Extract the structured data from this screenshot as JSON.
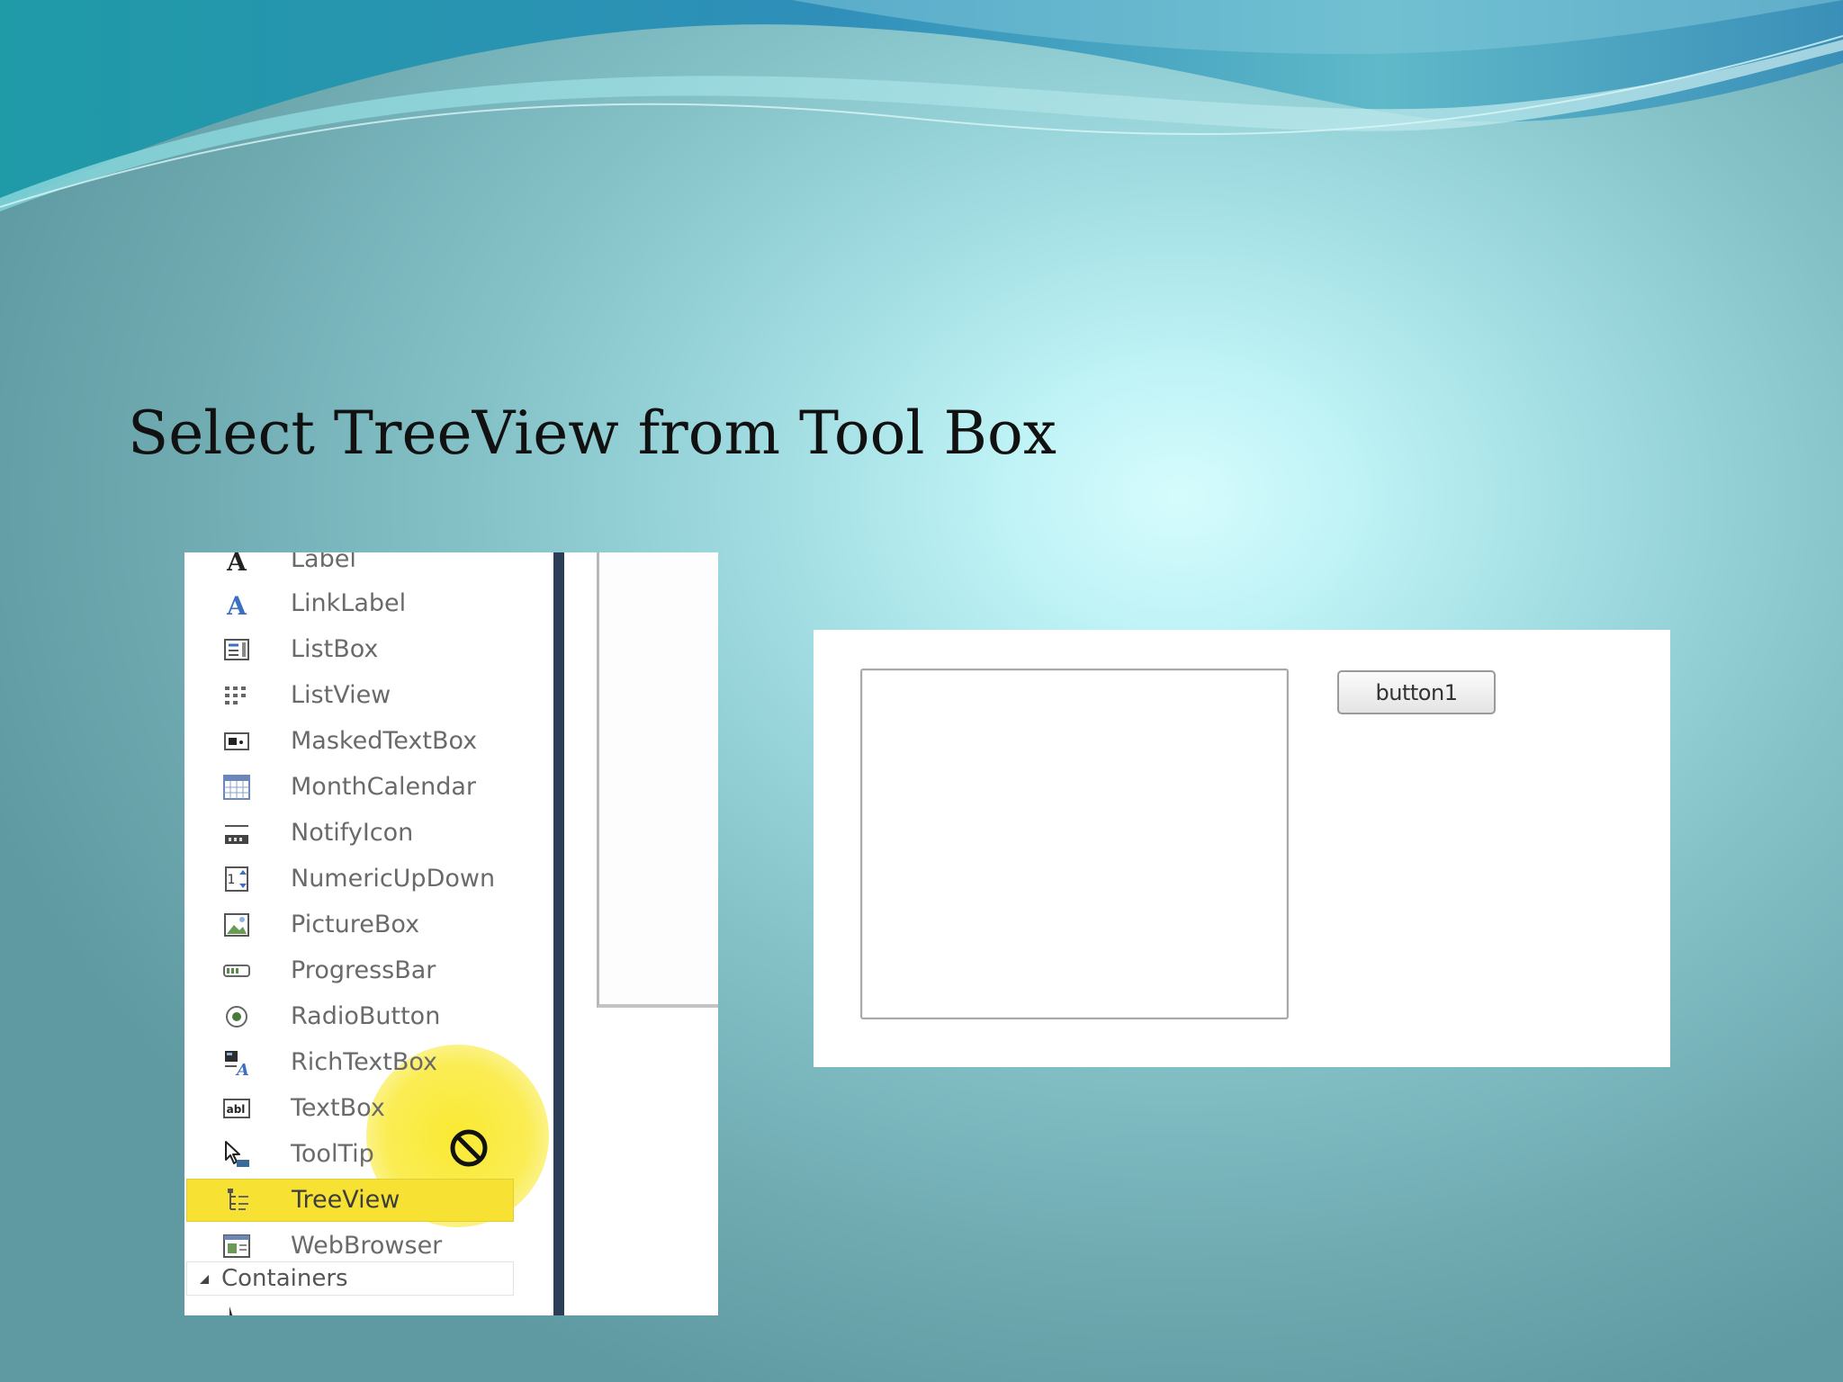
{
  "slide": {
    "title": "Select TreeView from Tool Box"
  },
  "toolbox": {
    "items": [
      {
        "label": "Label",
        "icon": "label-a-icon"
      },
      {
        "label": "LinkLabel",
        "icon": "linklabel-a-icon"
      },
      {
        "label": "ListBox",
        "icon": "listbox-icon"
      },
      {
        "label": "ListView",
        "icon": "listview-icon"
      },
      {
        "label": "MaskedTextBox",
        "icon": "maskedtextbox-icon"
      },
      {
        "label": "MonthCalendar",
        "icon": "calendar-grid-icon"
      },
      {
        "label": "NotifyIcon",
        "icon": "notify-tray-icon"
      },
      {
        "label": "NumericUpDown",
        "icon": "numeric-updown-icon"
      },
      {
        "label": "PictureBox",
        "icon": "picture-icon"
      },
      {
        "label": "ProgressBar",
        "icon": "progressbar-icon"
      },
      {
        "label": "RadioButton",
        "icon": "radio-icon"
      },
      {
        "label": "RichTextBox",
        "icon": "richtext-icon"
      },
      {
        "label": "TextBox",
        "icon": "textbox-abl-icon"
      },
      {
        "label": "ToolTip",
        "icon": "tooltip-pointer-icon"
      },
      {
        "label": "TreeView",
        "icon": "treeview-icon",
        "selected": true
      },
      {
        "label": "WebBrowser",
        "icon": "webbrowser-icon"
      }
    ],
    "group": {
      "label": "Containers",
      "icon": "expand-triangle-icon"
    },
    "cursor": {
      "icon": "no-drop-cursor-icon",
      "highlight_color": "#f7e233"
    }
  },
  "form": {
    "button_label": "button1"
  },
  "colors": {
    "wave_teal": "#2fa7b4",
    "wave_blue": "#3f86c1",
    "splitter": "#2c3e57",
    "selection": "#f7e233"
  }
}
